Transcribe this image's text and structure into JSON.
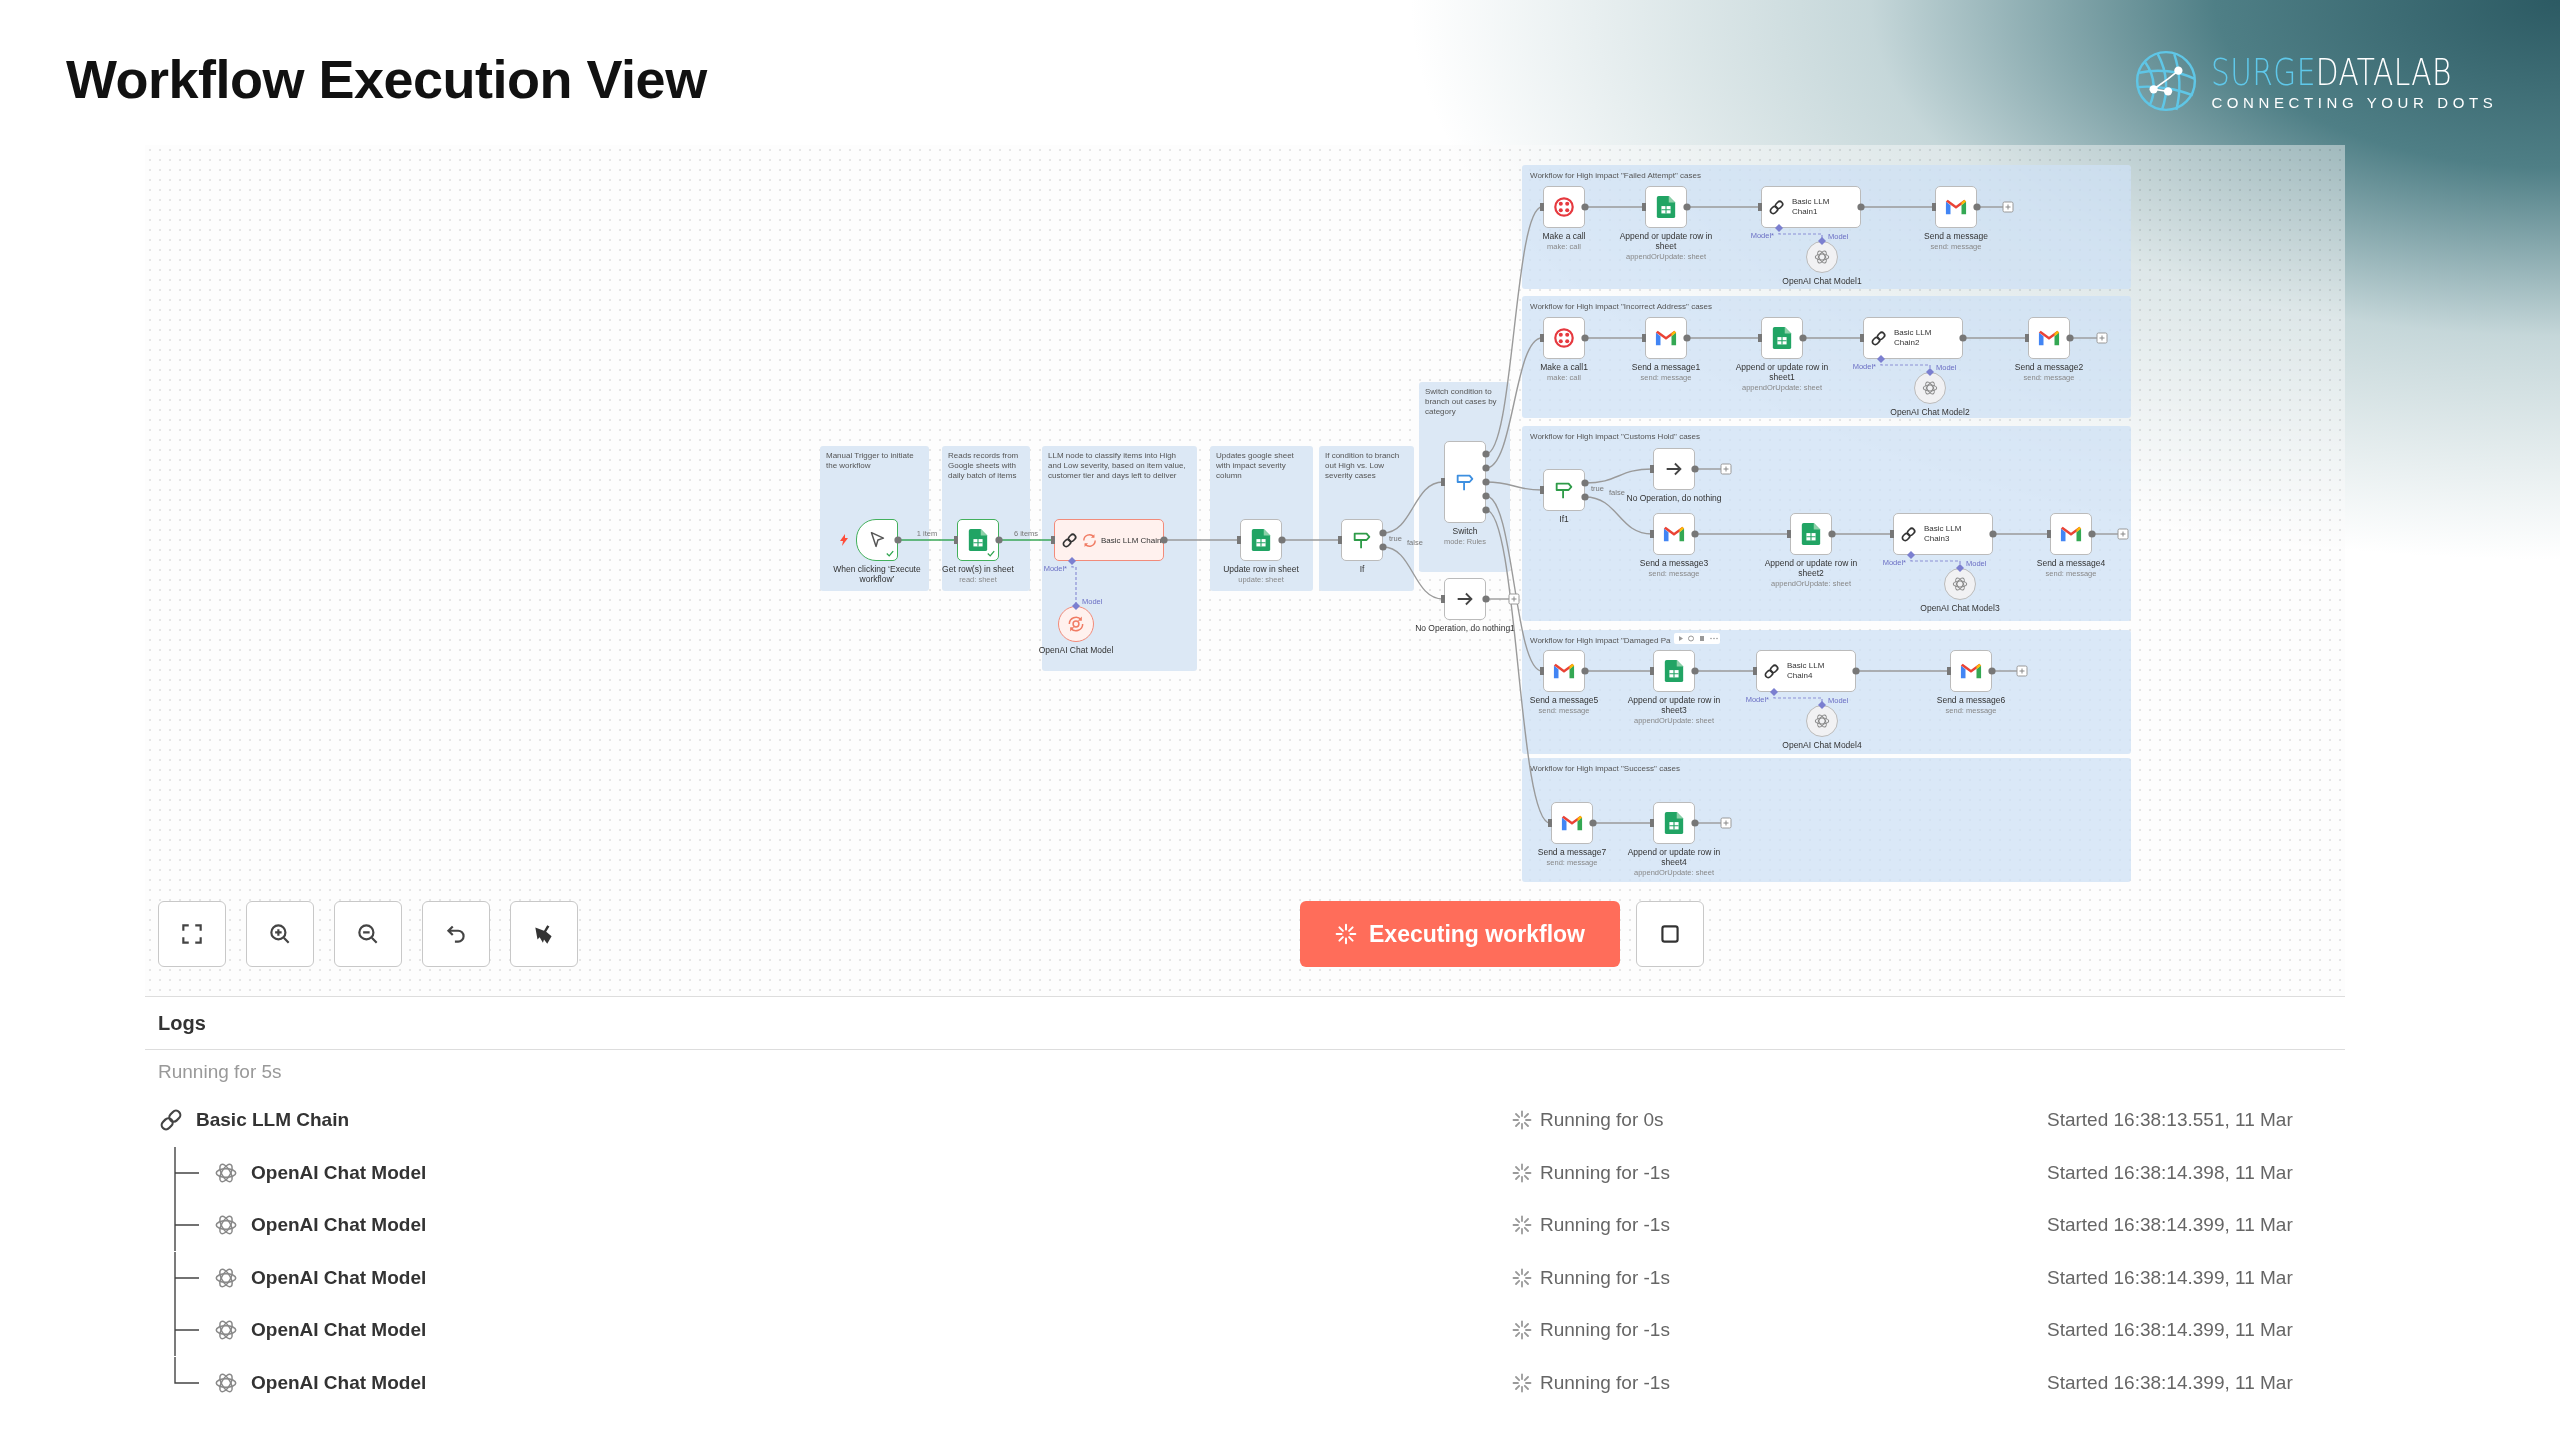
{
  "title": "Workflow Execution View",
  "logo": {
    "name_part1": "SURGE",
    "name_part2": "DATALAB",
    "tagline": "CONNECTING YOUR DOTS"
  },
  "notes": [
    {
      "text": "Manual Trigger to initiate the workflow"
    },
    {
      "text": "Reads records from Google sheets with daily batch of items"
    },
    {
      "text": "LLM node to classify items into High and Low severity, based on item value, customer tier and days left to deliver"
    },
    {
      "text": "Updates google sheet with impact severity column"
    },
    {
      "text": "If condition to branch out High vs. Low severity cases"
    },
    {
      "text": "Switch condition to branch out cases by category"
    }
  ],
  "nodes": [
    {
      "kind": "trigger",
      "label": "When clicking ‘Execute workflow’",
      "executed": true,
      "running": false,
      "output_label": "1 item"
    },
    {
      "kind": "sheets",
      "label": "Get row(s) in sheet",
      "subtitle": "read: sheet",
      "executed": true,
      "running": false,
      "output_label": "6 items"
    },
    {
      "kind": "llm",
      "label": "Basic LLM Chain",
      "executed": false,
      "running": true,
      "port_labels": [
        "Model*",
        "Model"
      ]
    },
    {
      "kind": "openai",
      "label": "OpenAI Chat Model",
      "executed": false,
      "running": true
    },
    {
      "kind": "sheets",
      "label": "Update row in sheet",
      "subtitle": "update: sheet",
      "executed": false,
      "running": false
    },
    {
      "kind": "if",
      "label": "If",
      "executed": false,
      "running": false,
      "output_labels": [
        "true",
        "false"
      ]
    },
    {
      "kind": "switch",
      "label": "Switch",
      "subtitle": "mode: Rules",
      "executed": false,
      "running": false
    },
    {
      "kind": "noop",
      "label": "No Operation, do nothing1",
      "executed": false,
      "running": false
    }
  ],
  "groups": [
    {
      "title": "Workflow for High impact \"Failed Attempt\" cases",
      "nodes": [
        {
          "kind": "call",
          "label": "Make a call",
          "subtitle": "make: call"
        },
        {
          "kind": "sheets",
          "label": "Append or update row in sheet",
          "subtitle": "appendOrUpdate: sheet"
        },
        {
          "kind": "llm",
          "label": "Basic LLM Chain1",
          "port_labels": [
            "Model*",
            "Model"
          ]
        },
        {
          "kind": "openai",
          "label": "OpenAI Chat Model1"
        },
        {
          "kind": "gmail",
          "label": "Send a message",
          "subtitle": "send: message"
        }
      ]
    },
    {
      "title": "Workflow for High impact \"Incorrect Address\" cases",
      "nodes": [
        {
          "kind": "call",
          "label": "Make a call1",
          "subtitle": "make: call"
        },
        {
          "kind": "gmail",
          "label": "Send a message1",
          "subtitle": "send: message"
        },
        {
          "kind": "sheets",
          "label": "Append or update row in sheet1",
          "subtitle": "appendOrUpdate: sheet"
        },
        {
          "kind": "llm",
          "label": "Basic LLM Chain2",
          "port_labels": [
            "Model*",
            "Model"
          ]
        },
        {
          "kind": "openai",
          "label": "OpenAI Chat Model2"
        },
        {
          "kind": "gmail",
          "label": "Send a message2",
          "subtitle": "send: message"
        }
      ]
    },
    {
      "title": "Workflow for High impact \"Customs Hold\" cases",
      "nodes": [
        {
          "kind": "if",
          "label": "If1",
          "output_labels": [
            "true",
            "false"
          ]
        },
        {
          "kind": "noop",
          "label": "No Operation, do nothing"
        },
        {
          "kind": "gmail",
          "label": "Send a message3",
          "subtitle": "send: message"
        },
        {
          "kind": "sheets",
          "label": "Append or update row in sheet2",
          "subtitle": "appendOrUpdate: sheet"
        },
        {
          "kind": "llm",
          "label": "Basic LLM Chain3",
          "port_labels": [
            "Model*",
            "Model"
          ]
        },
        {
          "kind": "openai",
          "label": "OpenAI Chat Model3"
        },
        {
          "kind": "gmail",
          "label": "Send a message4",
          "subtitle": "send: message"
        }
      ]
    },
    {
      "title": "Workflow for High impact \"Damaged Pa",
      "nodes": [
        {
          "kind": "gmail",
          "label": "Send a message5",
          "subtitle": "send: message"
        },
        {
          "kind": "sheets",
          "label": "Append or update row in sheet3",
          "subtitle": "appendOrUpdate: sheet"
        },
        {
          "kind": "llm",
          "label": "Basic LLM Chain4",
          "port_labels": [
            "Model*",
            "Model"
          ]
        },
        {
          "kind": "openai",
          "label": "OpenAI Chat Model4"
        },
        {
          "kind": "gmail",
          "label": "Send a message6",
          "subtitle": "send: message"
        }
      ]
    },
    {
      "title": "Workflow for High impact \"Success\" cases",
      "nodes": [
        {
          "kind": "gmail",
          "label": "Send a message7",
          "subtitle": "send: message"
        },
        {
          "kind": "sheets",
          "label": "Append or update row in sheet4",
          "subtitle": "appendOrUpdate: sheet"
        }
      ]
    }
  ],
  "run_button": {
    "label": "Executing workflow"
  },
  "logs": {
    "title": "Logs",
    "summary": "Running for 5s",
    "entries": [
      {
        "kind": "chain",
        "name": "Basic LLM Chain",
        "status": "Running for 0s",
        "started": "Started 16:38:13.551, 11 Mar",
        "children": [
          {
            "kind": "model",
            "name": "OpenAI Chat Model",
            "status": "Running for -1s",
            "started": "Started 16:38:14.398, 11 Mar"
          },
          {
            "kind": "model",
            "name": "OpenAI Chat Model",
            "status": "Running for -1s",
            "started": "Started 16:38:14.399, 11 Mar"
          },
          {
            "kind": "model",
            "name": "OpenAI Chat Model",
            "status": "Running for -1s",
            "started": "Started 16:38:14.399, 11 Mar"
          },
          {
            "kind": "model",
            "name": "OpenAI Chat Model",
            "status": "Running for -1s",
            "started": "Started 16:38:14.399, 11 Mar"
          },
          {
            "kind": "model",
            "name": "OpenAI Chat Model",
            "status": "Running for -1s",
            "started": "Started 16:38:14.399, 11 Mar"
          }
        ]
      }
    ]
  }
}
